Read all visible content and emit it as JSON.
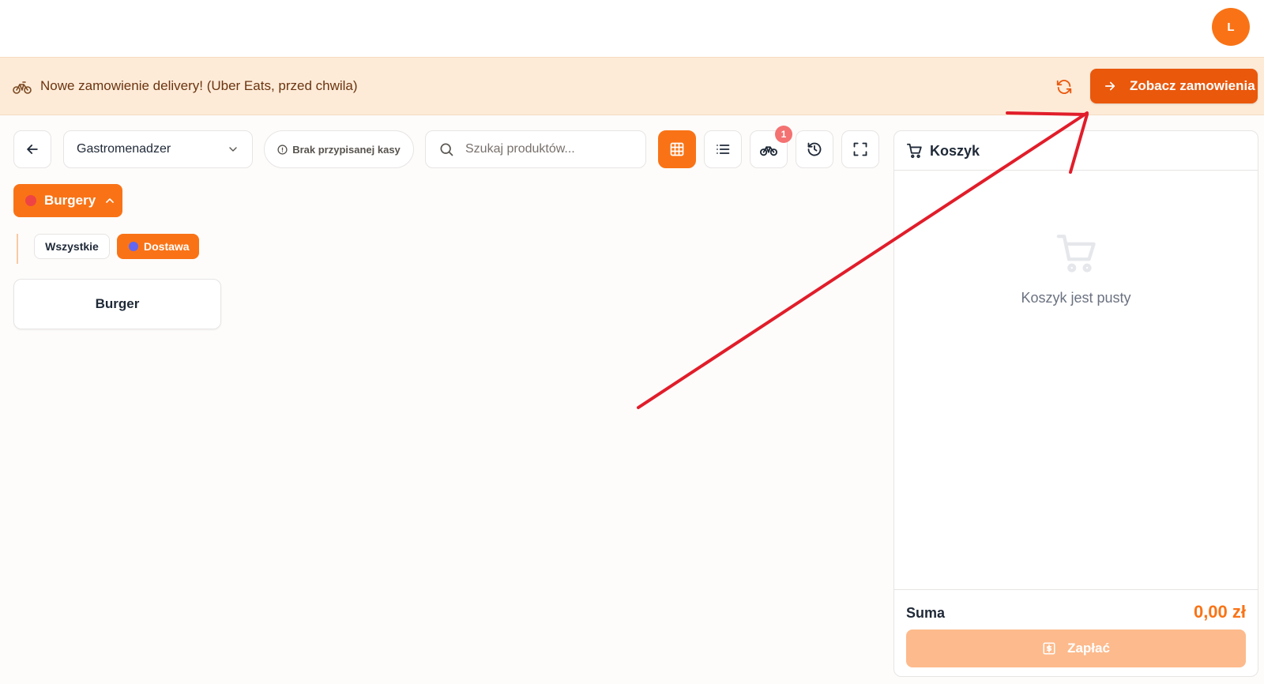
{
  "header": {
    "avatar_initial": "L"
  },
  "banner": {
    "icon": "bicycle-icon",
    "message": "Nowe zamowienie delivery! (Uber Eats, przed chwila)",
    "refresh_icon": "refresh-icon",
    "orders_button_label": "Zobacz zamowienia"
  },
  "toolbar": {
    "back_icon": "arrow-left-icon",
    "location_selected": "Gastromenadzer",
    "register_status": "Brak przypisanej kasy",
    "search_placeholder": "Szukaj produktów...",
    "tools": [
      {
        "icon": "grid-icon",
        "active": true
      },
      {
        "icon": "list-icon",
        "active": false
      },
      {
        "icon": "bicycle-icon",
        "active": false,
        "badge": "1"
      },
      {
        "icon": "history-icon",
        "active": false
      },
      {
        "icon": "fullscreen-icon",
        "active": false
      }
    ],
    "delivery_badge": "1"
  },
  "categories": {
    "selected": {
      "label": "Burgery",
      "dot_color": "#ef4444"
    },
    "subcategories": [
      {
        "label": "Wszystkie",
        "active": false
      },
      {
        "label": "Dostawa",
        "active": true,
        "dot_color": "#6366f1"
      }
    ]
  },
  "products": [
    {
      "name": "Burger"
    }
  ],
  "cart": {
    "title": "Koszyk",
    "empty_message": "Koszyk jest pusty",
    "sum_label": "Suma",
    "sum_value": "0,00 zł",
    "pay_label": "Zapłać"
  },
  "colors": {
    "accent": "#f97316",
    "accent_dark": "#ea580c",
    "banner_bg": "#fdebd8",
    "annotation_arrow": "#e11d2a"
  }
}
